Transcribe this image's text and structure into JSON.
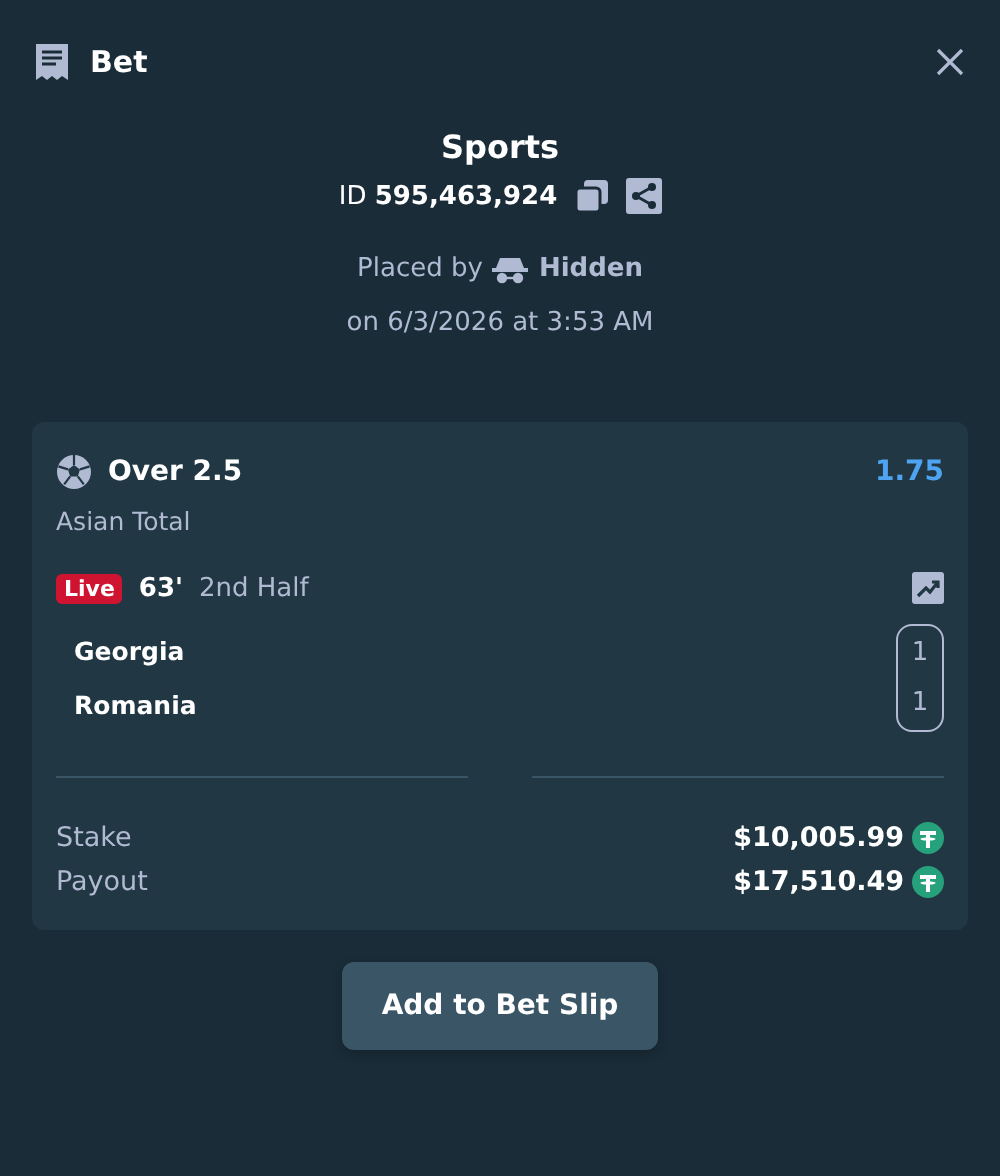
{
  "header": {
    "title": "Bet"
  },
  "summary": {
    "title": "Sports",
    "id_line": "ID **595,463,924**",
    "placed_by_label": "Placed by",
    "placed_by_user": "Hidden",
    "placed_on": "on 6/3/2026 at 3:53 AM"
  },
  "selection": {
    "outcome": "Over 2.5",
    "odds": "1.75",
    "market": "Asian Total",
    "status_badge": "Live",
    "minute": "63'",
    "period": "2nd Half",
    "teams": [
      {
        "name": "Georgia",
        "score": "1"
      },
      {
        "name": "Romania",
        "score": "1"
      }
    ]
  },
  "totals": [
    {
      "label": "Stake",
      "amount": "$10,005.99"
    },
    {
      "label": "Payout",
      "amount": "$17,510.49"
    }
  ],
  "action_button": "Add to Bet Slip"
}
